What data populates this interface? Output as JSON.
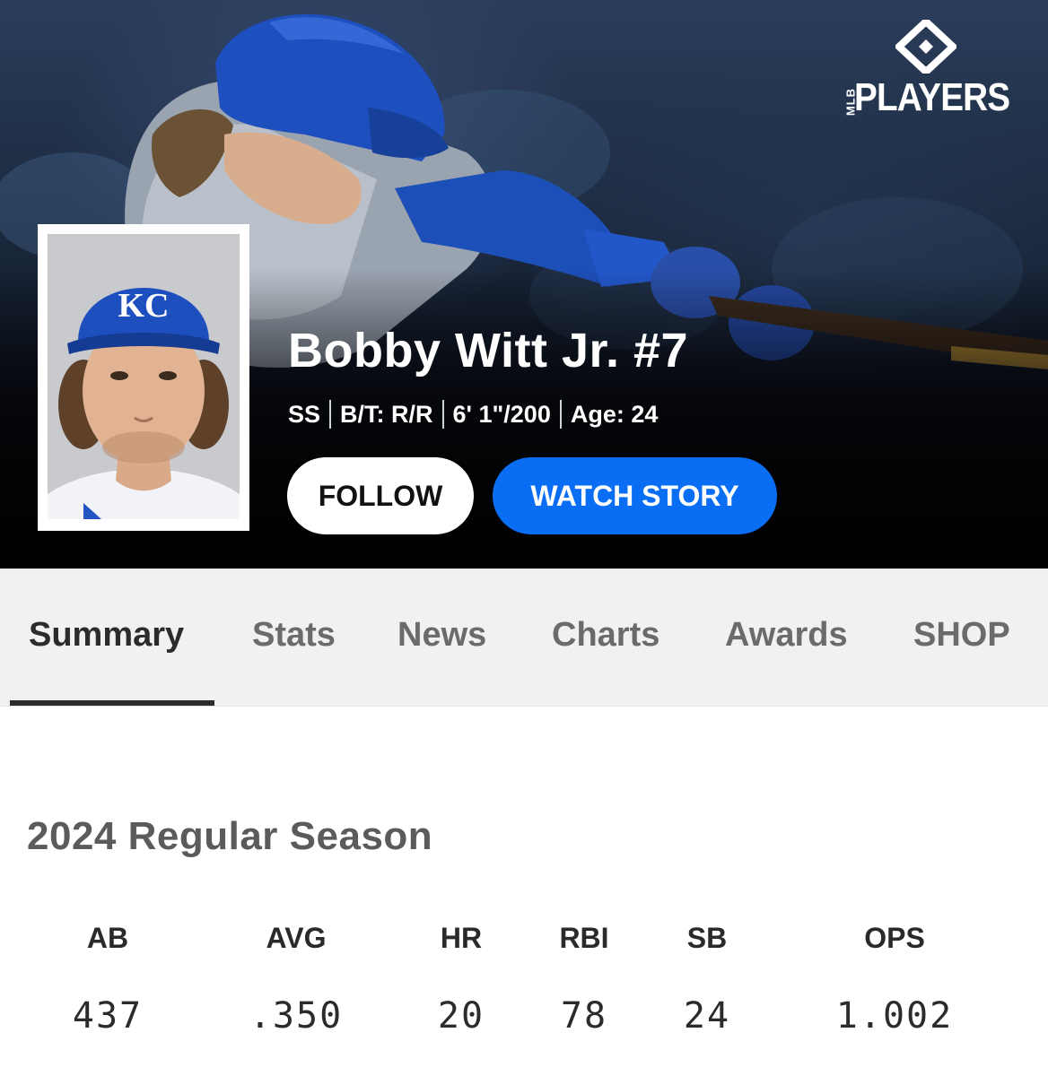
{
  "brand": {
    "logo_small": "MLB",
    "logo_text": "PLAYERS",
    "icon": "mlbpa-diamond-icon"
  },
  "player": {
    "name": "Bobby Witt Jr. #7",
    "position": "SS",
    "bats_throws": "B/T: R/R",
    "height_weight": "6' 1\"/200",
    "age": "Age: 24",
    "cap_logo": "KC"
  },
  "actions": {
    "follow_label": "FOLLOW",
    "watch_label": "WATCH STORY"
  },
  "tabs": [
    {
      "label": "Summary",
      "active": true
    },
    {
      "label": "Stats",
      "active": false
    },
    {
      "label": "News",
      "active": false
    },
    {
      "label": "Charts",
      "active": false
    },
    {
      "label": "Awards",
      "active": false
    },
    {
      "label": "SHOP",
      "active": false
    }
  ],
  "season": {
    "title": "2024 Regular Season",
    "stats": [
      {
        "label": "AB",
        "value": "437"
      },
      {
        "label": "AVG",
        "value": ".350"
      },
      {
        "label": "HR",
        "value": "20"
      },
      {
        "label": "RBI",
        "value": "78"
      },
      {
        "label": "SB",
        "value": "24"
      },
      {
        "label": "OPS",
        "value": "1.002"
      }
    ]
  },
  "colors": {
    "accent_blue": "#0a6ef5",
    "royals_blue": "#1d4fb8",
    "hero_dark": "#050608"
  }
}
